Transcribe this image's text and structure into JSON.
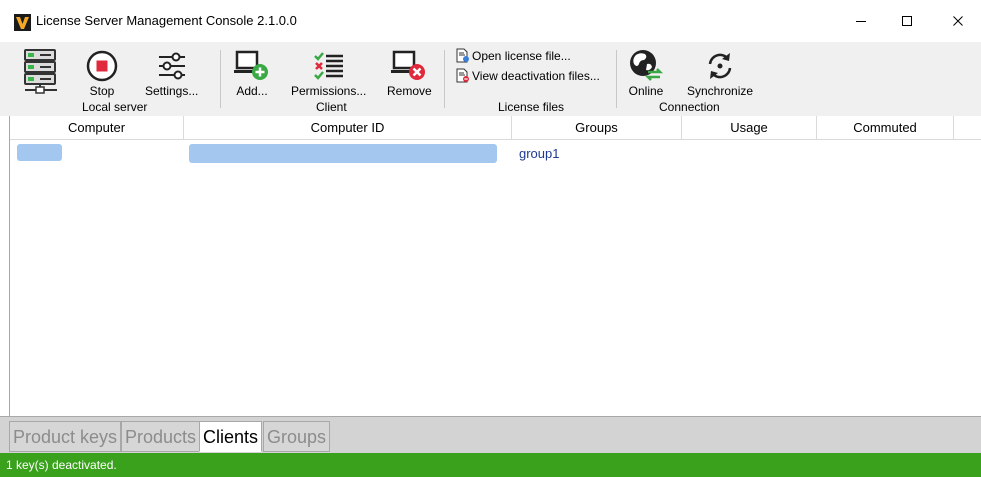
{
  "window": {
    "title": "License Server Management Console 2.1.0.0",
    "controls": {
      "minimize": "minimize-icon",
      "maximize": "maximize-icon",
      "close": "close-icon"
    }
  },
  "ribbon": {
    "local_server": {
      "group_label": "Local server",
      "stop_label": "Stop",
      "settings_label": "Settings..."
    },
    "client": {
      "group_label": "Client",
      "add_label": "Add...",
      "permissions_label": "Permissions...",
      "remove_label": "Remove"
    },
    "license_files": {
      "group_label": "License files",
      "open_label": "Open license file...",
      "view_deactivation_label": "View deactivation files..."
    },
    "connection": {
      "group_label": "Connection",
      "online_label": "Online",
      "synchronize_label": "Synchronize"
    }
  },
  "grid": {
    "columns": [
      "Computer",
      "Computer ID",
      "Groups",
      "Usage",
      "Commuted"
    ],
    "rows": [
      {
        "computer": "",
        "computer_id": "",
        "groups": "group1",
        "usage": "",
        "commuted": ""
      }
    ]
  },
  "tabs": [
    {
      "label": "Product keys",
      "active": false
    },
    {
      "label": "Products",
      "active": false
    },
    {
      "label": "Clients",
      "active": true
    },
    {
      "label": "Groups",
      "active": false
    }
  ],
  "status": {
    "text": "1 key(s) deactivated.",
    "color": "#3aa11d"
  },
  "colors": {
    "accent_link": "#1f3a93",
    "redaction": "#a3c7ee",
    "logo_orange": "#f5a623"
  }
}
